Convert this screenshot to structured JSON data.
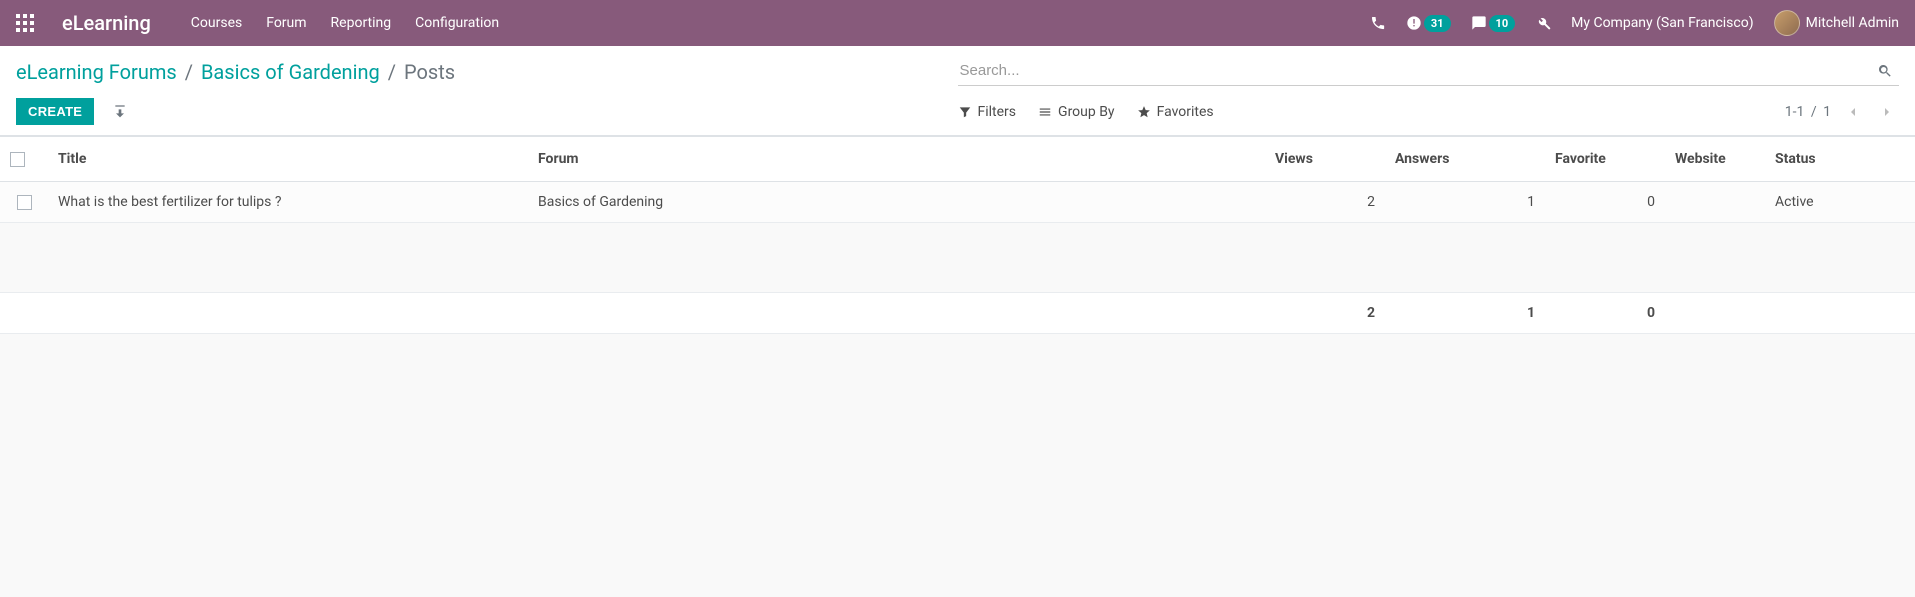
{
  "navbar": {
    "brand": "eLearning",
    "menu": [
      "Courses",
      "Forum",
      "Reporting",
      "Configuration"
    ],
    "activity_badge": "31",
    "messages_badge": "10",
    "company": "My Company (San Francisco)",
    "user": "Mitchell Admin"
  },
  "breadcrumb": {
    "items": [
      {
        "label": "eLearning Forums"
      },
      {
        "label": "Basics of Gardening"
      }
    ],
    "current": "Posts",
    "sep": "/"
  },
  "search": {
    "placeholder": "Search..."
  },
  "buttons": {
    "create": "CREATE"
  },
  "filters": {
    "filters": "Filters",
    "group_by": "Group By",
    "favorites": "Favorites"
  },
  "pager": {
    "range": "1-1",
    "sep": "/",
    "total": "1"
  },
  "table": {
    "columns": {
      "title": "Title",
      "forum": "Forum",
      "views": "Views",
      "answers": "Answers",
      "favorite": "Favorite",
      "website": "Website",
      "status": "Status"
    },
    "rows": [
      {
        "title": "What is the best fertilizer for tulips ?",
        "forum": "Basics of Gardening",
        "views": "2",
        "answers": "1",
        "favorite": "0",
        "website": "",
        "status": "Active"
      }
    ],
    "totals": {
      "views": "2",
      "answers": "1",
      "favorite": "0"
    }
  }
}
